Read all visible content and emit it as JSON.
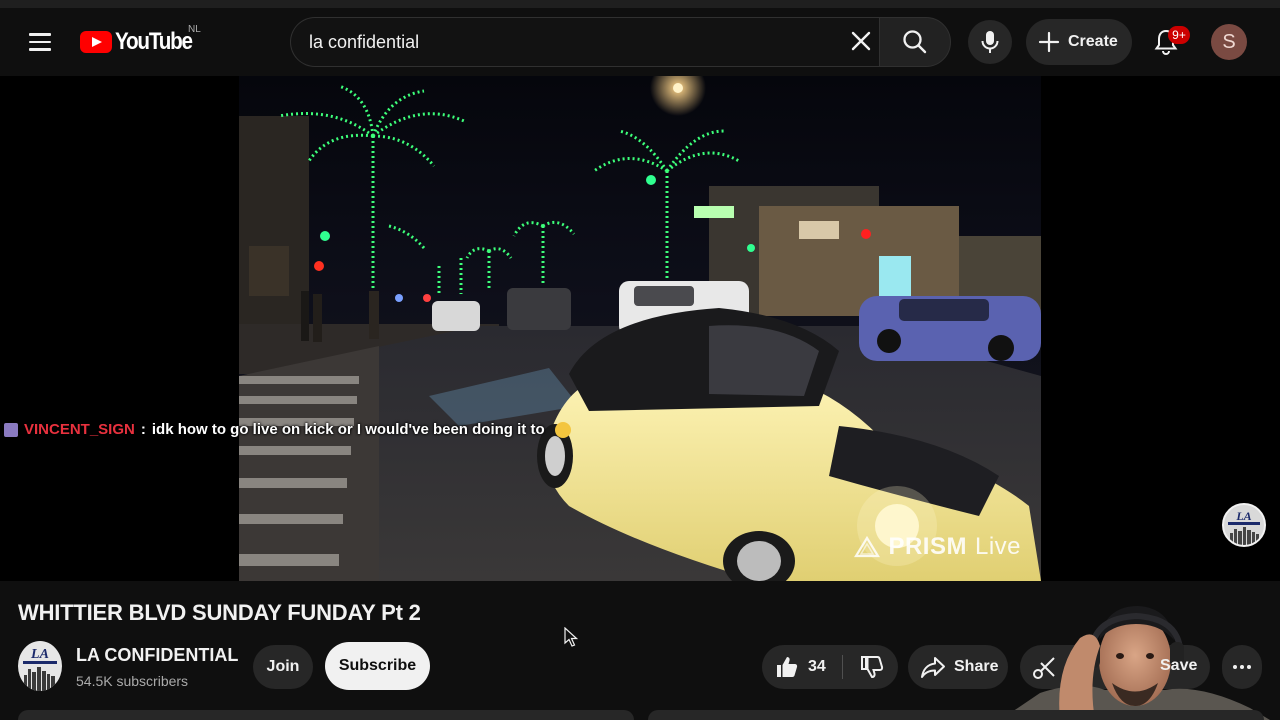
{
  "header": {
    "logo_text": "YouTube",
    "region": "NL",
    "search_value": "la confidential",
    "create_label": "Create",
    "notification_count": "9+",
    "avatar_initial": "S"
  },
  "player": {
    "watermark_brand": "PRISM",
    "watermark_suffix": "Live",
    "chat": {
      "username": "VINCENT_SIGN",
      "separator": ":",
      "message": "idk how to go live on kick or I would've been doing it to"
    }
  },
  "video": {
    "title": "WHITTIER BLVD SUNDAY FUNDAY Pt 2"
  },
  "channel": {
    "name": "LA CONFIDENTIAL",
    "subscribers": "54.5K subscribers",
    "join_label": "Join",
    "subscribe_label": "Subscribe"
  },
  "actions": {
    "like_count": "34",
    "share_label": "Share",
    "save_label": "Save"
  },
  "colors": {
    "brand_red": "#ff0000",
    "background": "#0f0f0f",
    "chip": "#272727",
    "chat_username": "#e8313e"
  }
}
